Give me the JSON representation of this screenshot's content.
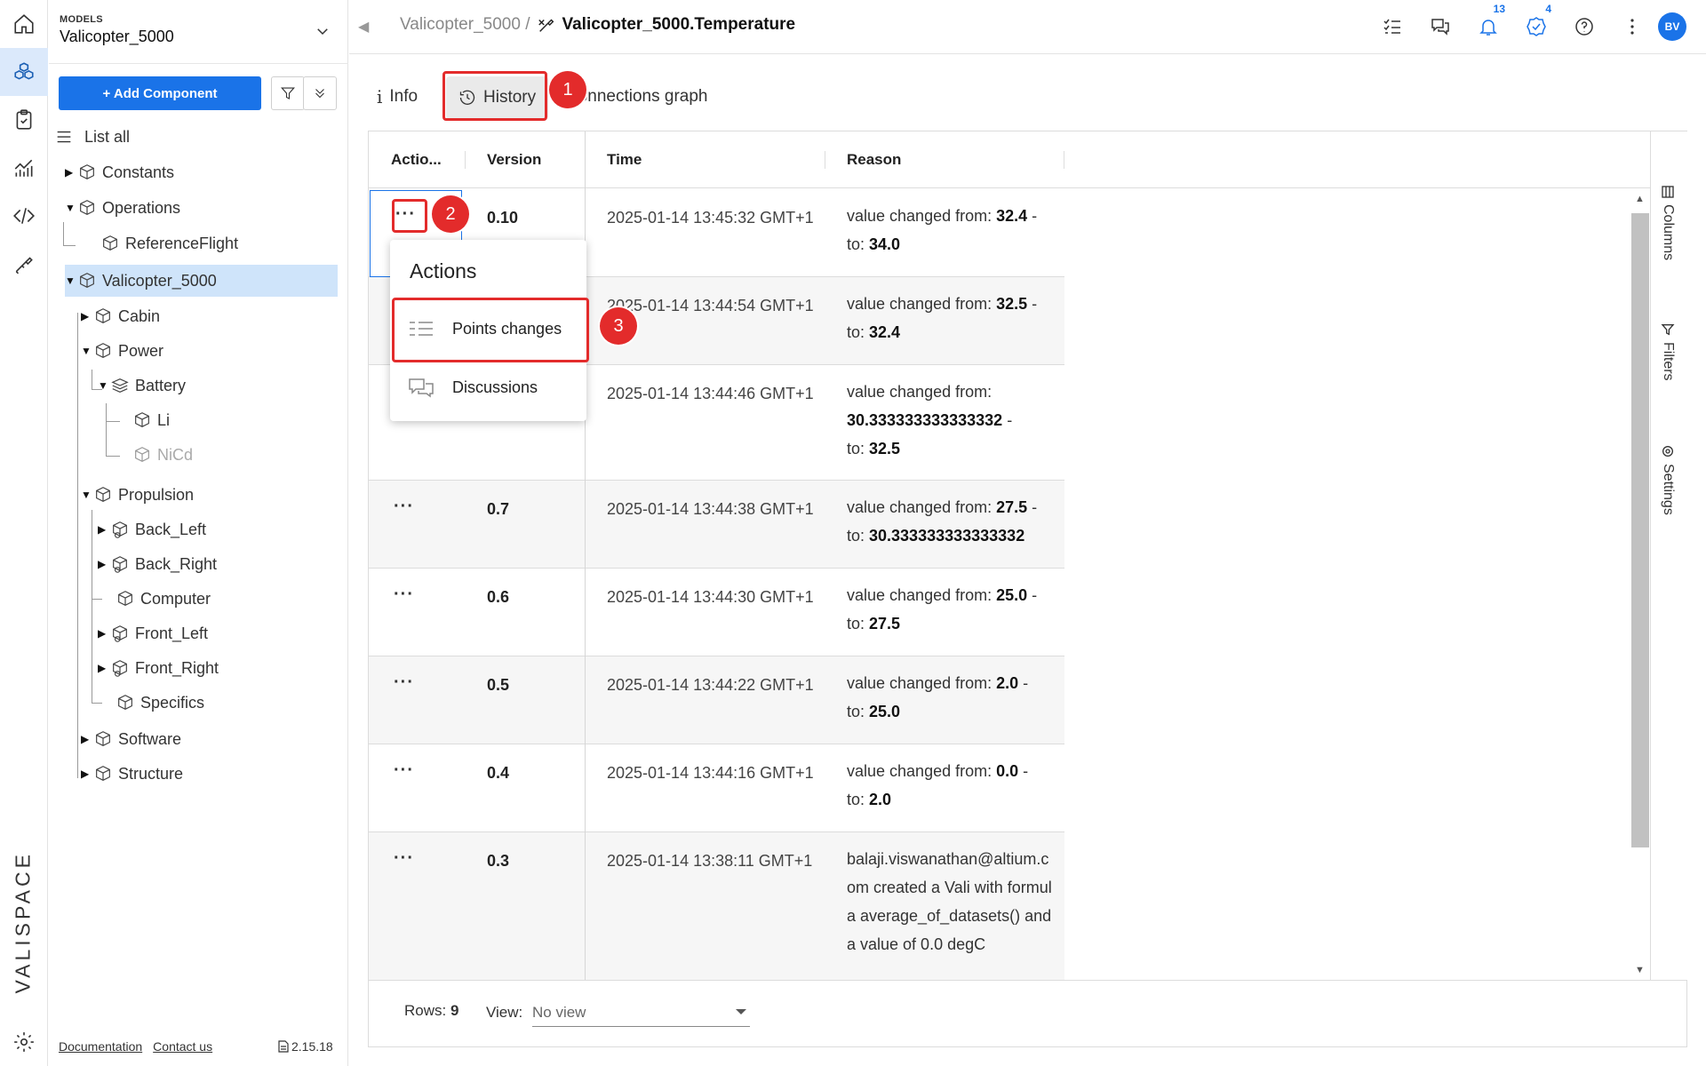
{
  "rail": {
    "items": [
      "home-icon",
      "models-icon",
      "requirements-icon",
      "analytics-icon",
      "code-icon",
      "tools-icon"
    ],
    "brand": "VALISPACE"
  },
  "sidebar": {
    "model_label": "MODELS",
    "model_value": "Valicopter_5000",
    "add_component": "+ Add Component",
    "tree": [
      {
        "label": "List all"
      },
      {
        "label": "Constants"
      },
      {
        "label": "Operations"
      },
      {
        "label": "ReferenceFlight"
      },
      {
        "label": "Valicopter_5000"
      },
      {
        "label": "Cabin"
      },
      {
        "label": "Power"
      },
      {
        "label": "Battery"
      },
      {
        "label": "Li"
      },
      {
        "label": "NiCd"
      },
      {
        "label": "Propulsion"
      },
      {
        "label": "Back_Left"
      },
      {
        "label": "Back_Right"
      },
      {
        "label": "Computer"
      },
      {
        "label": "Front_Left"
      },
      {
        "label": "Front_Right"
      },
      {
        "label": "Specifics"
      },
      {
        "label": "Software"
      },
      {
        "label": "Structure"
      }
    ],
    "footer": {
      "documentation": "Documentation",
      "contact": "Contact us",
      "version": "2.15.18"
    }
  },
  "header": {
    "breadcrumb_root": "Valicopter_5000 /",
    "breadcrumb_current": "Valicopter_5000.Temperature",
    "notifications_count": "13",
    "tasks_count": "4",
    "avatar_initials": "BV"
  },
  "tabs": {
    "info": "Info",
    "history": "History",
    "connections": "Connections graph"
  },
  "markers": {
    "m1": "1",
    "m2": "2",
    "m3": "3"
  },
  "grid": {
    "columns": [
      "Actio...",
      "Version",
      "Time",
      "Reason"
    ],
    "rows": [
      {
        "actions": "···",
        "version": "0.10",
        "time": "2025-01-14 13:45:32 GMT+1",
        "reason_prefix": "value changed from: ",
        "from": "32.4",
        "to": "34.0"
      },
      {
        "actions": "",
        "version": "",
        "time": "2025-01-14 13:44:54 GMT+1",
        "reason_prefix": "value changed from: ",
        "from": "32.5",
        "to": "32.4"
      },
      {
        "actions": "",
        "version": "",
        "time": "2025-01-14 13:44:46 GMT+1",
        "reason_prefix": "value changed from:",
        "from": "30.333333333333332",
        "to": "32.5"
      },
      {
        "actions": "···",
        "version": "0.7",
        "time": "2025-01-14 13:44:38 GMT+1",
        "reason_prefix": "value changed from: ",
        "from": "27.5",
        "to": "30.333333333333332"
      },
      {
        "actions": "···",
        "version": "0.6",
        "time": "2025-01-14 13:44:30 GMT+1",
        "reason_prefix": "value changed from: ",
        "from": "25.0",
        "to": "27.5"
      },
      {
        "actions": "···",
        "version": "0.5",
        "time": "2025-01-14 13:44:22 GMT+1",
        "reason_prefix": "value changed from: ",
        "from": "2.0",
        "to": "25.0"
      },
      {
        "actions": "···",
        "version": "0.4",
        "time": "2025-01-14 13:44:16 GMT+1",
        "reason_prefix": "value changed from: ",
        "from": "0.0",
        "to": "2.0"
      },
      {
        "actions": "···",
        "version": "0.3",
        "time": "2025-01-14 13:38:11 GMT+1",
        "reason_text": "balaji.viswanathan@altium.com created a Vali with formula average_of_datasets() and a value of 0.0 degC"
      }
    ],
    "to_label": "to: ",
    "dash": " -",
    "side_panel": [
      "Columns",
      "Filters",
      "Settings"
    ],
    "footer": {
      "rows_label": "Rows: ",
      "rows_value": "9",
      "view_label": "View:",
      "view_value": "No view"
    }
  },
  "popup": {
    "title": "Actions",
    "items": [
      "Points changes",
      "Discussions"
    ]
  },
  "colors": {
    "accent": "#1a73e8",
    "highlight": "#e32b2b",
    "selected": "#cfe4fa"
  }
}
